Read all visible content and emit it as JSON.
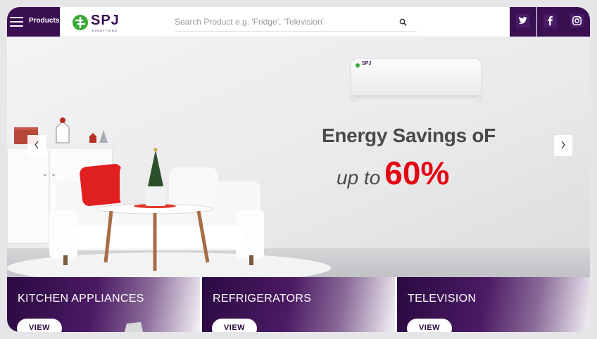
{
  "header": {
    "menu_label": "Products",
    "logo_text": "SPJ",
    "logo_tagline": "EVERYTHING",
    "search_placeholder": "Search Product e.g. 'Fridge', 'Television'",
    "social": [
      "twitter-icon",
      "facebook-icon",
      "instagram-icon"
    ]
  },
  "hero": {
    "ac_brand": "SPJ",
    "headline_line1": "Energy Savings oF",
    "headline_line2_pre": "up to",
    "headline_line2_pct": "60%",
    "prev_icon": "chevron-left-icon",
    "next_icon": "chevron-right-icon"
  },
  "categories": [
    {
      "title": "KITCHEN APPLIANCES",
      "button": "VIEW"
    },
    {
      "title": "REFRIGERATORS",
      "button": "VIEW"
    },
    {
      "title": "TELEVISION",
      "button": "VIEW"
    }
  ],
  "colors": {
    "brand": "#3a1052",
    "accent": "#e30613",
    "logo_green": "#3aa935"
  }
}
